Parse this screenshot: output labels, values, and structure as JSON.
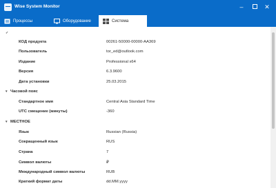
{
  "window": {
    "title": "Wise System Monitor"
  },
  "tabs": [
    {
      "label": "Процессы"
    },
    {
      "label": "Оборудование"
    },
    {
      "label": "Система"
    }
  ],
  "system": {
    "rows": [
      {
        "label": "КОД продукта",
        "value": "00261-50000-00000-AA369"
      },
      {
        "label": "Пользователь",
        "value": "tor_ed@outlook.com"
      },
      {
        "label": "Издание",
        "value": "Professional x64"
      },
      {
        "label": "Версия",
        "value": "6.3.9600"
      },
      {
        "label": "Дата установки",
        "value": "25.03.2015"
      }
    ],
    "timezone": {
      "title": "Часовой пояс",
      "rows": [
        {
          "label": "Стандартное имя",
          "value": "Central Asia Standard Time"
        },
        {
          "label": "UTC смещение (минуты)",
          "value": "-360"
        }
      ]
    },
    "locale": {
      "title": "МЕСТНОЕ",
      "rows": [
        {
          "label": "Язык",
          "value": "Russian (Russia)"
        },
        {
          "label": "Сокращенный язык",
          "value": "RUS"
        },
        {
          "label": "Страна",
          "value": "7"
        },
        {
          "label": "Символ валюты",
          "value": "₽"
        },
        {
          "label": "Международный символ валюты",
          "value": "RUB"
        },
        {
          "label": "Краткий формат даты",
          "value": "dd.MM.yyyy"
        }
      ]
    }
  }
}
